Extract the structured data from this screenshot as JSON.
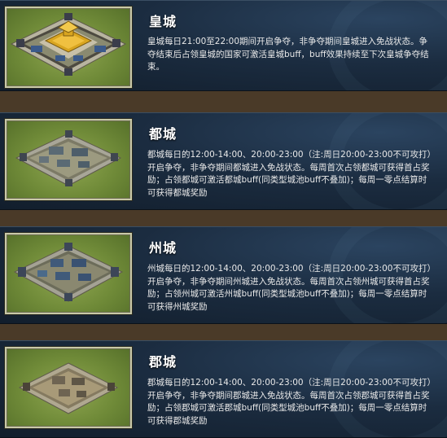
{
  "cities": [
    {
      "title": "皇城",
      "description": "皇城每日21:00至22:00期间开启争夺，非争夺期间皇城进入免战状态。争夺结束后占领皇城的国家可激活皇城buff，buff效果持续至下次皇城争夺结束。"
    },
    {
      "title": "都城",
      "description": "都城每日的12:00-14:00、20:00-23:00（注:周日20:00-23:00不可攻打）开启争夺，非争夺期间都城进入免战状态。每周首次占领都城可获得首占奖励；占领都城可激活都城buff(同类型城池buff不叠加)；每周一零点结算时可获得都城奖励"
    },
    {
      "title": "州城",
      "description": "州城每日的12:00-14:00、20:00-23:00（注:周日20:00-23:00不可攻打）开启争夺，非争夺期间州城进入免战状态。每周首次占领州城可获得首占奖励；占领州城可激活州城buff(同类型城池buff不叠加)；每周一零点结算时可获得州城奖励"
    },
    {
      "title": "郡城",
      "description": "郡城每日的12:00-14:00、20:00-23:00（注:周日20:00-23:00不可攻打）开启争夺，非争夺期间郡城进入免战状态。每周首次占领郡城可获得首占奖励；占领郡城可激活郡城buff(同类型城池buff不叠加)；每周一零点结算时可获得郡城奖励"
    }
  ],
  "colors": {
    "panel": "#1b2c40",
    "grass": "#6f8a38",
    "gold_roof": "#d9a520",
    "wall": "#8e8e86"
  },
  "icons": [
    "imperial-city-image",
    "capital-city-image",
    "province-city-image",
    "prefecture-city-image"
  ]
}
